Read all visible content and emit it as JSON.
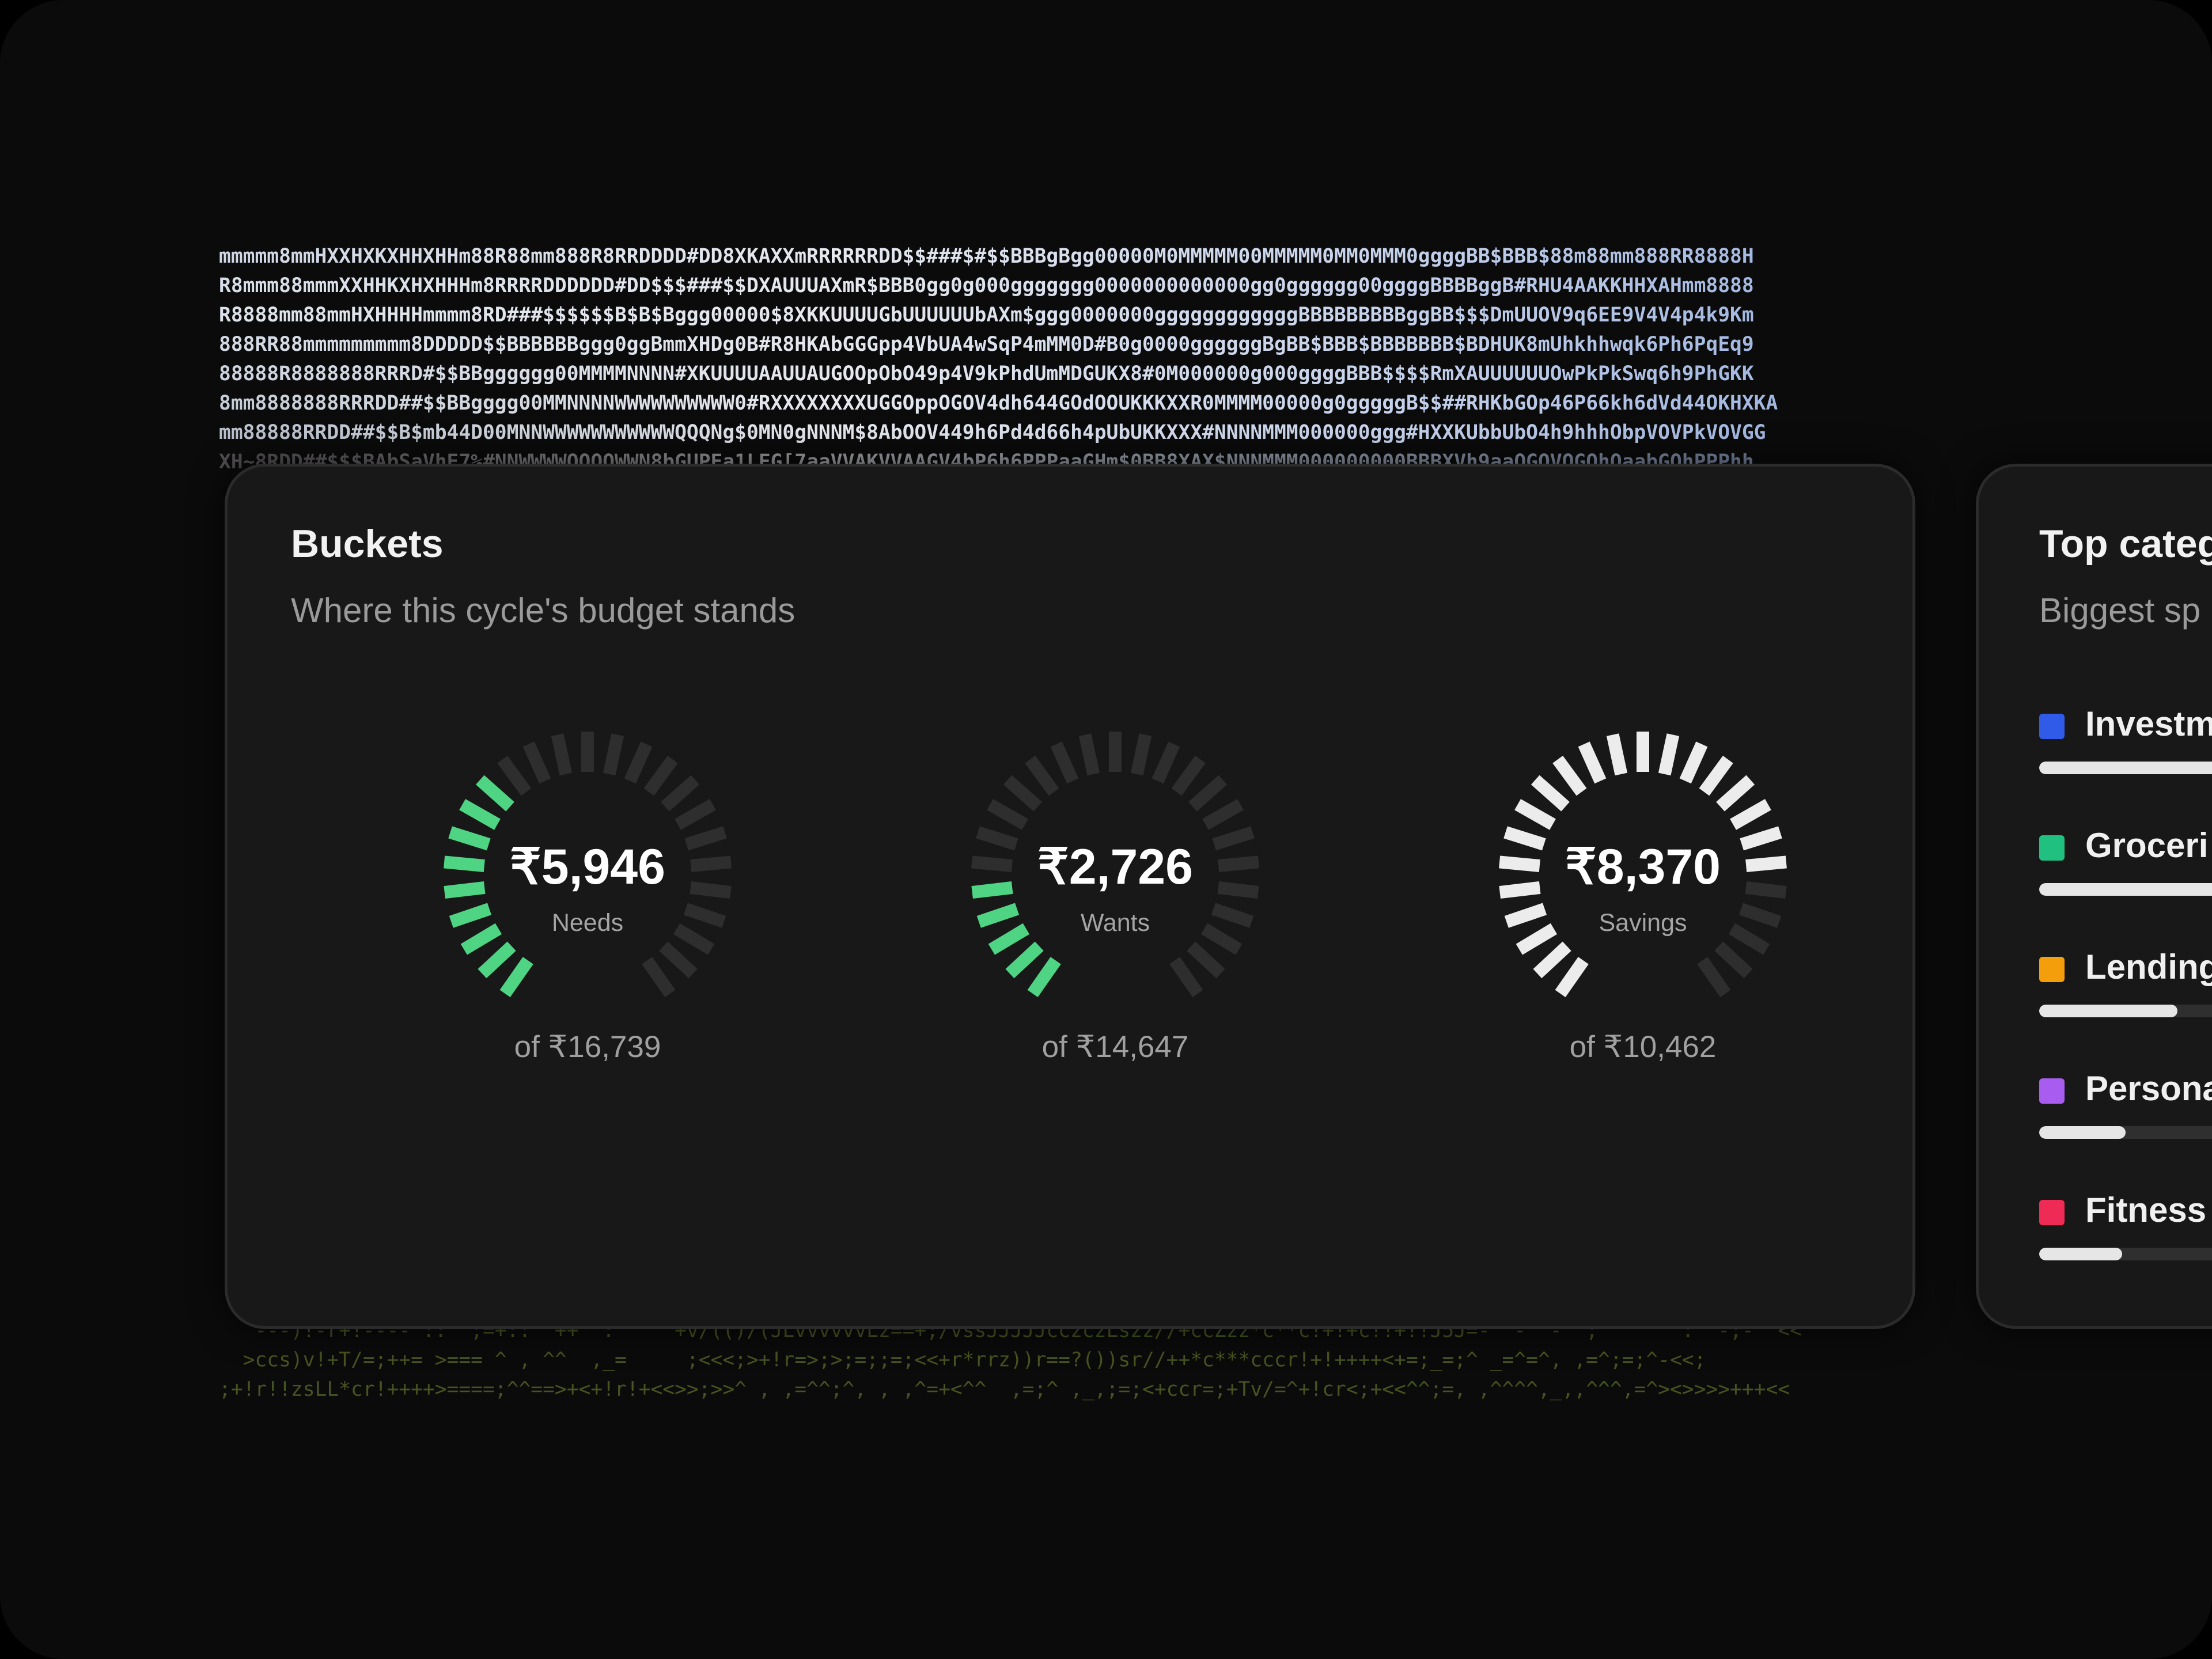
{
  "ascii_art": {
    "top_lines": [
      "mmmmm8mmHXXHXKXHHXHHm88R88mm888R8RRDDDD#DD8XKAXXmRRRRRRDD$$###$#$$BBBgBgg00000M0MMMMM00MMMMM0MM0MMM0ggggBB$BBB$88m88mm888RR8888H",
      "R8mmm88mmmXXHHKXHXHHHm8RRRRDDDDDD#DD$$$###$$DXAUUUAXmR$BBB0gg0g000ggggggg0000000000000gg0gggggg00ggggBBBBggB#RHU4AAKKHHXAHmm8888",
      "R8888mm88mmHXHHHHmmmm8RD###$$$$$$B$B$Bggg00000$8XKKUUUUGbUUUUUUbAXm$ggg0000000ggggggggggggBBBBBBBBBggBB$$$DmUUOV9q6EE9V4V4p4k9Km",
      "888RR88mmmmmmmmm8DDDDD$$BBBBBBggg0ggBmmXHDg0B#R8HKAbGGGpp4VbUA4wSqP4mMM0D#B0g0000ggggggBgBB$BBB$BBBBBBB$BDHUK8mUhkhhwqk6Ph6PqEq9",
      "88888R8888888RRRD#$$BBgggggg00MMMMNNNN#XKUUUUAAUUAUGOOpObO49p4V9kPhdUmMDGUKX8#0M000000g000ggggBBB$$$$RmXAUUUUUUOwPkPkSwq6h9PhGKK",
      "8mm8888888RRRDD##$$BBgggg00MMNNNNWWWWWWWWWW0#RXXXXXXXXUGGOppOGOV4dh644GOdOOUKKKXXR0MMMM00000g0gggggB$$##RHKbGOp46P66kh6dVd44OKHXKA",
      "mm88888RRDD##$$B$mb44D00MNNWWWWWWWWWWWQQQNg$0MN0gNNNM$8AbOOV449h6Pd4d66h4pUbUKKXXX#NNNNMMM000000ggg#HXXKUbbUbO4h9hhhObpVOVPkVOVGG",
      "XH~8RDD##$$$BAbSaVhE7%#NNWWWWQQQQWWN8bGUPEa1LFG[7aaVVAKVVAAGV4bP6h6PPPaaGHm$0BB8XAX$NNNMMM000000000BBBXVh9aaOGOVOGOhOaabGOhPPPhh"
    ],
    "bottom_lines": [
      "   ---)!-r+!---- ::  ;=+::  ++  :     +v/(()/(JLvvvvvvLz==+;/vssJJJJJcczczLszz//+ccZzz*c**c!+!+c!!+!!J5J=-  -  -  ;    ^  :  -;-  <<",
      "  >ccs)v!+T/=;++= >=== ^ , ^^  ,_=     ;<<<;>+!r=>;>;=;;=;<<+r*rrz))r==?())sr//++*c***cccr!+!++++<+=;_=;^ _=^=^, ,=^;=;^-<<;",
      ";+!r!!zsLL*cr!++++>====;^^==>+<+!r!+<<>>;>>^ , ,=^^;^, , ,^=+<^^  ,=;^ ,_,;=;<+ccr=;+Tv/=^+!cr<;+<<^^;=, ,^^^^,_,,^^^,=^><>>>>+++<<"
    ]
  },
  "buckets": {
    "title": "Buckets",
    "subtitle": "Where this cycle's budget stands",
    "gauges": [
      {
        "amount": "₹5,946",
        "label": "Needs",
        "total": "of ₹16,739",
        "ratio": 0.355,
        "color": "#4ed483"
      },
      {
        "amount": "₹2,726",
        "label": "Wants",
        "total": "of ₹14,647",
        "ratio": 0.186,
        "color": "#4ed483"
      },
      {
        "amount": "₹8,370",
        "label": "Savings",
        "total": "of ₹10,462",
        "ratio": 0.8,
        "color": "#ececec"
      }
    ]
  },
  "top_categories": {
    "title": "Top categ",
    "subtitle": "Biggest sp",
    "items": [
      {
        "name": "Investm",
        "color": "#2f5be8",
        "fill": 1.0
      },
      {
        "name": "Groceri",
        "color": "#1fc080",
        "fill": 1.0
      },
      {
        "name": "Lending",
        "color": "#f59e0b",
        "fill": 0.4
      },
      {
        "name": "Persona",
        "color": "#a85cf0",
        "fill": 0.25
      },
      {
        "name": "Fitness",
        "color": "#ef2a55",
        "fill": 0.24
      }
    ]
  }
}
